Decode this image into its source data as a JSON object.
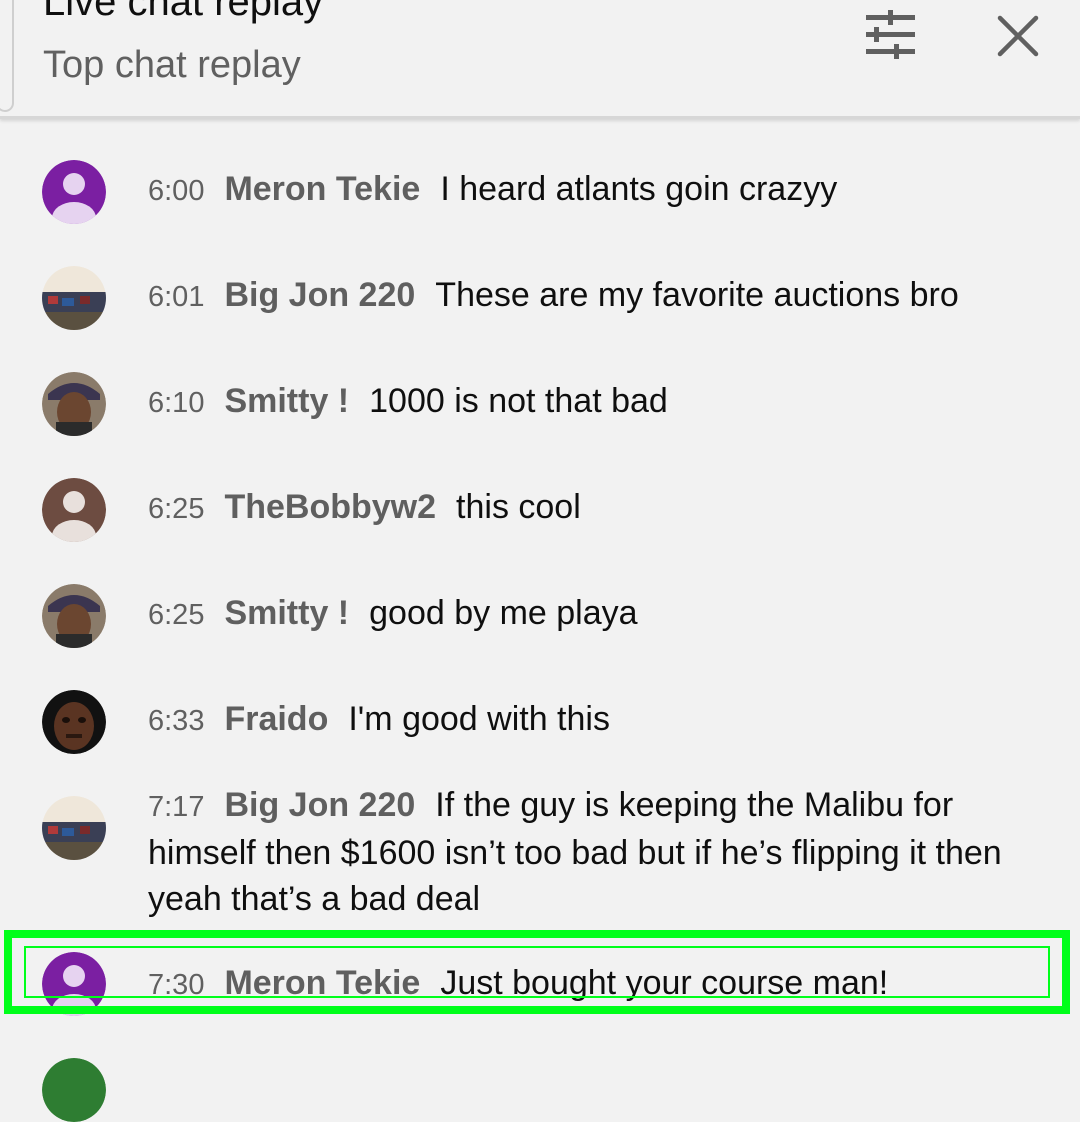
{
  "header": {
    "title": "Live chat replay",
    "subtitle": "Top chat replay",
    "filter_icon": "tune-icon",
    "close_icon": "close-icon"
  },
  "colors": {
    "purple_avatar": "#7b1fa2",
    "brown_avatar": "#6d4c41",
    "green_avatar": "#2e7d32",
    "highlight": "#00ff1a"
  },
  "messages": [
    {
      "time": "6:00",
      "author": "Meron Tekie",
      "text": "I heard atlants goin crazyy",
      "avatar": "purple-default-avatar"
    },
    {
      "time": "6:01",
      "author": "Big Jon 220",
      "text": "These are my favorite auctions bro",
      "avatar": "photo-avatar"
    },
    {
      "time": "6:10",
      "author": "Smitty !",
      "text": "1000 is not that bad",
      "avatar": "photo-avatar"
    },
    {
      "time": "6:25",
      "author": "TheBobbyw2",
      "text": "this cool",
      "avatar": "brown-default-avatar"
    },
    {
      "time": "6:25",
      "author": "Smitty !",
      "text": "good by me playa",
      "avatar": "photo-avatar"
    },
    {
      "time": "6:33",
      "author": "Fraido",
      "text": "I'm good with this",
      "avatar": "photo-avatar"
    },
    {
      "time": "7:17",
      "author": "Big Jon 220",
      "text": "If the guy is keeping the Malibu for himself then $1600 isn’t too bad but if he’s flipping it then yeah that’s a bad deal",
      "avatar": "photo-avatar"
    },
    {
      "time": "7:30",
      "author": "Meron Tekie",
      "text": "Just bought your course man!",
      "avatar": "purple-default-avatar"
    }
  ]
}
